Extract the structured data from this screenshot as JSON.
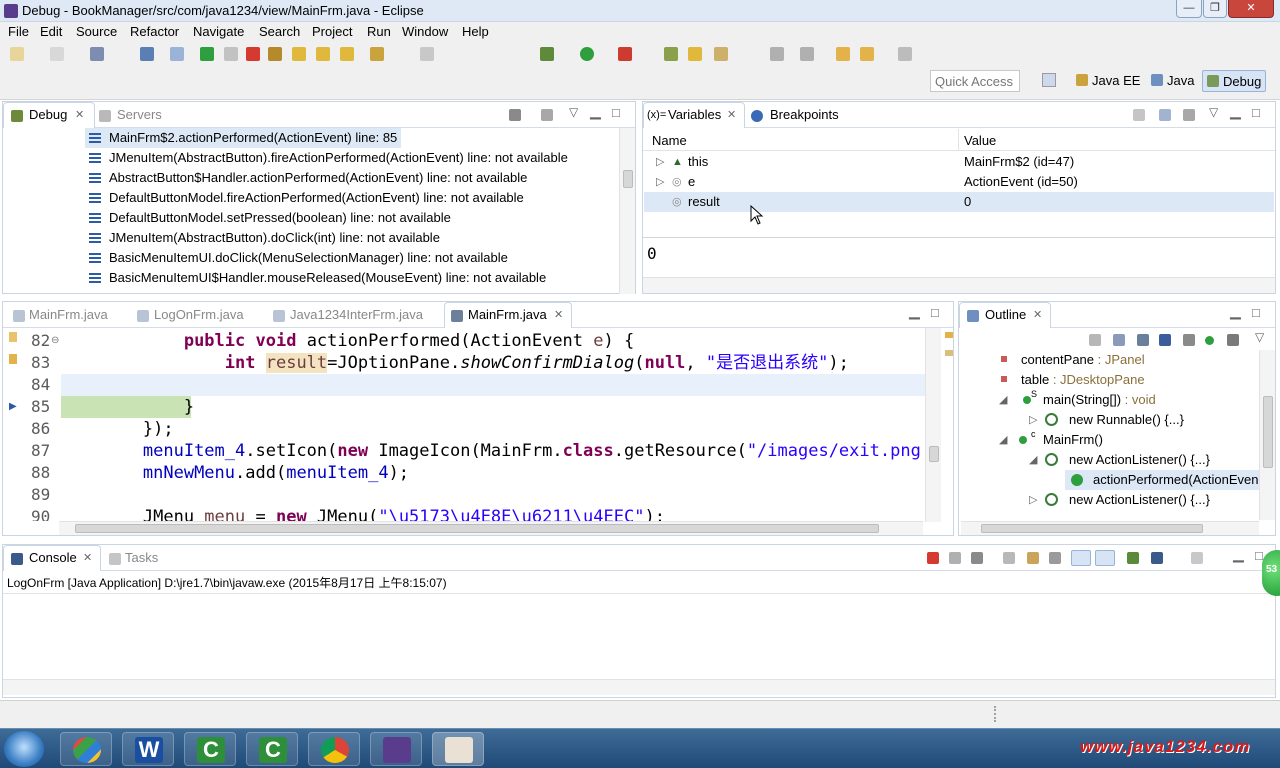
{
  "window": {
    "title": "Debug - BookManager/src/com/java1234/view/MainFrm.java - Eclipse"
  },
  "menu": [
    "File",
    "Edit",
    "Source",
    "Refactor",
    "Navigate",
    "Search",
    "Project",
    "Run",
    "Window",
    "Help"
  ],
  "quick_access": {
    "placeholder": "Quick Access"
  },
  "perspectives": [
    "Java EE",
    "Java",
    "Debug"
  ],
  "debug_panel": {
    "tabs": [
      "Debug",
      "Servers"
    ],
    "frames": [
      "MainFrm$2.actionPerformed(ActionEvent) line: 85",
      "JMenuItem(AbstractButton).fireActionPerformed(ActionEvent) line: not available",
      "AbstractButton$Handler.actionPerformed(ActionEvent) line: not available",
      "DefaultButtonModel.fireActionPerformed(ActionEvent) line: not available",
      "DefaultButtonModel.setPressed(boolean) line: not available",
      "JMenuItem(AbstractButton).doClick(int) line: not available",
      "BasicMenuItemUI.doClick(MenuSelectionManager) line: not available",
      "BasicMenuItemUI$Handler.mouseReleased(MouseEvent) line: not available"
    ]
  },
  "variables_panel": {
    "tabs": [
      "Variables",
      "Breakpoints"
    ],
    "tab_prefix": "(x)=",
    "columns": [
      "Name",
      "Value"
    ],
    "rows": [
      {
        "name": "this",
        "value": "MainFrm$2  (id=47)"
      },
      {
        "name": "e",
        "value": "ActionEvent  (id=50)"
      },
      {
        "name": "result",
        "value": "0"
      }
    ],
    "detail": "0"
  },
  "editor": {
    "tabs": [
      "MainFrm.java",
      "LogOnFrm.java",
      "Java1234InterFrm.java",
      "MainFrm.java"
    ],
    "line_numbers": [
      "82",
      "83",
      "84",
      "85",
      "86",
      "87",
      "88",
      "89",
      "90"
    ]
  },
  "outline": {
    "tab": "Outline",
    "items": [
      {
        "name": "contentPane",
        "type": " : JPanel"
      },
      {
        "name": "table",
        "type": " : JDesktopPane"
      },
      {
        "name": "main(String[])",
        "type": " : void"
      },
      {
        "name": "new Runnable() {...}",
        "type": ""
      },
      {
        "name": "MainFrm()",
        "type": ""
      },
      {
        "name": "new ActionListener() {...}",
        "type": ""
      },
      {
        "name": "actionPerformed(ActionEven",
        "type": ""
      },
      {
        "name": "new ActionListener() {...}",
        "type": ""
      }
    ],
    "super_marks": [
      "S",
      "c"
    ]
  },
  "console": {
    "tabs": [
      "Console",
      "Tasks"
    ],
    "launch": "LogOnFrm [Java Application] D:\\jre1.7\\bin\\javaw.exe (2015年8月17日 上午8:15:07)"
  },
  "watermark": "www.java1234.com",
  "badge": "53",
  "colors": {
    "accent": "#dde8f6",
    "keyword": "#7f0055",
    "string": "#2a00ff"
  }
}
